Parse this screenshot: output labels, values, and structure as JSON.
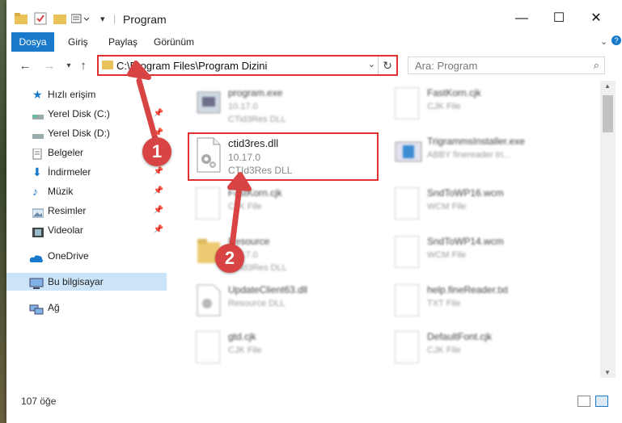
{
  "window": {
    "title": "Program"
  },
  "ribbon": {
    "tabs": [
      "Dosya",
      "Giriş",
      "Paylaş",
      "Görünüm"
    ]
  },
  "address": {
    "path": "C:\\Program Files\\Program Dizini"
  },
  "search": {
    "placeholder": "Ara: Program"
  },
  "sidebar": {
    "items": [
      {
        "label": "Hızlı erişim",
        "pinned": false
      },
      {
        "label": "Yerel Disk (C:)",
        "pinned": true
      },
      {
        "label": "Yerel Disk (D:)",
        "pinned": true
      },
      {
        "label": "Belgeler",
        "pinned": true
      },
      {
        "label": "İndirmeler",
        "pinned": true
      },
      {
        "label": "Müzik",
        "pinned": true
      },
      {
        "label": "Resimler",
        "pinned": true
      },
      {
        "label": "Videolar",
        "pinned": true
      },
      {
        "label": "OneDrive",
        "pinned": false
      },
      {
        "label": "Bu bilgisayar",
        "pinned": false
      },
      {
        "label": "Ağ",
        "pinned": false
      }
    ]
  },
  "files": {
    "left": [
      {
        "name": "program.exe",
        "l2": "10.17.0",
        "l3": "CTid3Res DLL"
      },
      {
        "name": "ctid3res.dll",
        "l2": "10.17.0",
        "l3": "CTId3Res DLL"
      },
      {
        "name": "FastKorn.cjk",
        "l2": "CJK File",
        "l3": ""
      },
      {
        "name": "Resource",
        "l2": "10.17.0",
        "l3": "CTId3Res DLL"
      },
      {
        "name": "UpdateClient63.dll",
        "l2": "Resource DLL",
        "l3": ""
      },
      {
        "name": "gtd.cjk",
        "l2": "CJK File",
        "l3": ""
      }
    ],
    "right": [
      {
        "name": "FastKorn.cjk",
        "l2": "CJK File",
        "l3": ""
      },
      {
        "name": "TrigrammsInstaller.exe",
        "l2": "ABBY finereader tri...",
        "l3": ""
      },
      {
        "name": "SndToWP16.wcm",
        "l2": "WCM File",
        "l3": ""
      },
      {
        "name": "SndToWP14.wcm",
        "l2": "WCM File",
        "l3": ""
      },
      {
        "name": "help.fineReader.txt",
        "l2": "TXT File",
        "l3": ""
      },
      {
        "name": "DefaultFont.cjk",
        "l2": "CJK File",
        "l3": ""
      }
    ]
  },
  "status": {
    "count": "107 öğe"
  },
  "annotations": {
    "badge1": "1",
    "badge2": "2"
  }
}
